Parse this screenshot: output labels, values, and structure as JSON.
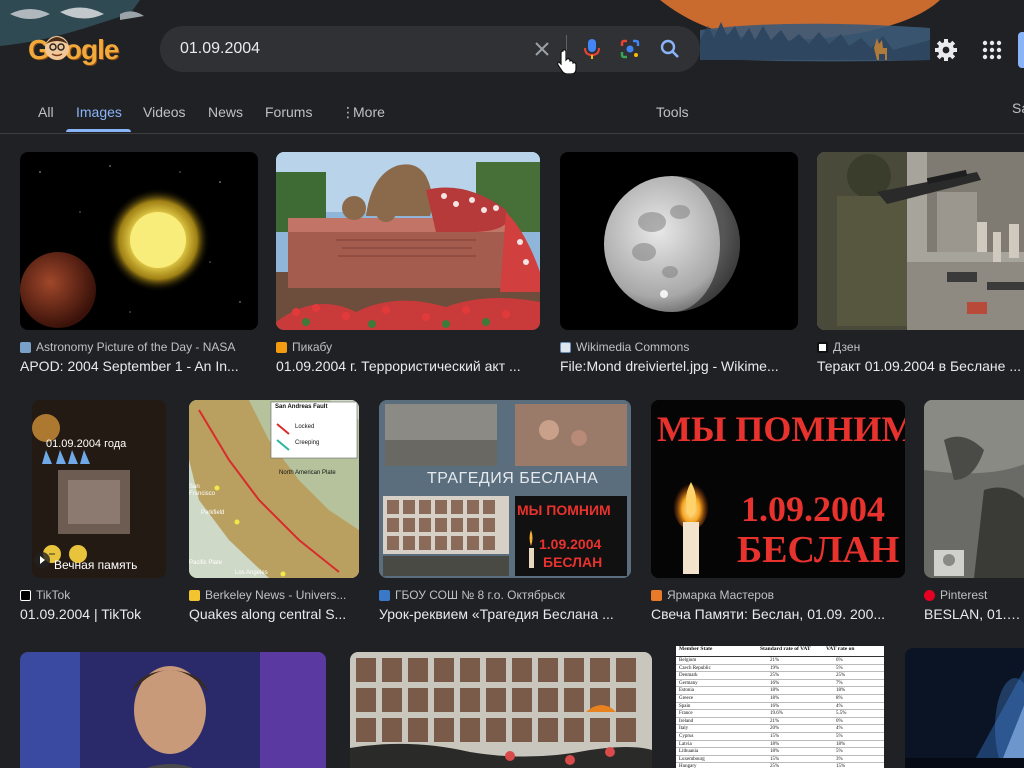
{
  "search": {
    "query": "01.09.2004"
  },
  "logo": {
    "text": "Google"
  },
  "tabs": {
    "all": "All",
    "images": "Images",
    "videos": "Videos",
    "news": "News",
    "forums": "Forums",
    "more": "More",
    "tools": "Tools",
    "safe_search_partial": "Sa"
  },
  "colors": {
    "accent": "#8ab4f8",
    "background": "#202124",
    "search_box": "#303134"
  },
  "results": [
    {
      "source": "Astronomy Picture of the Day - NASA",
      "title": "APOD: 2004 September 1 - An In..."
    },
    {
      "source": "Пикабу",
      "title": "01.09.2004 г. Террористический акт ..."
    },
    {
      "source": "Wikimedia Commons",
      "title": "File:Mond dreiviertel.jpg - Wikime..."
    },
    {
      "source": "Дзен",
      "title": "Теракт 01.09.2004 в Беслане ..."
    },
    {
      "source": "TikTok",
      "title": "01.09.2004 | TikTok",
      "overlay_text": "01.09.2004 года",
      "overlay_caption": "Вечная память"
    },
    {
      "source": "Berkeley News - Univers...",
      "title": "Quakes along central S...",
      "map": {
        "legend_title": "San Andreas Fault",
        "legend_locked": "Locked",
        "legend_creeping": "Creeping",
        "north_american_plate": "North American Plate",
        "pacific_plate": "Pacific Plate",
        "san_francisco": "San Francisco",
        "parkfield": "Parkfield",
        "los_angeles": "Los Angeles"
      }
    },
    {
      "source": "ГБОУ СОШ № 8 г.о. Октябрьск",
      "title": "Урок-реквием «Трагедия Беслана ...",
      "banner": "ТРАГЕДИЯ БЕСЛАНА",
      "small_line1": "МЫ ПОМНИМ",
      "small_line2": "1.09.2004",
      "small_line3": "БЕСЛАН"
    },
    {
      "source": "Ярмарка Мастеров",
      "title": "Свеча Памяти: Беслан, 01.09. 200...",
      "line1": "МЫ ПОМНИМ",
      "line2": "1.09.2004",
      "line3": "БЕСЛАН"
    },
    {
      "source": "Pinterest",
      "title": "BESLAN, 01.09..."
    },
    {
      "source": "",
      "title": ""
    },
    {
      "source": "",
      "title": ""
    },
    {
      "source": "",
      "title": ""
    },
    {
      "source": "",
      "title": ""
    }
  ],
  "vat_table": {
    "headers": [
      "Member State",
      "Standard rate of VAT",
      "VAT rate on"
    ],
    "rows": [
      [
        "Belgium",
        "21%",
        "6%"
      ],
      [
        "Czech Republic",
        "19%",
        "5%"
      ],
      [
        "Denmark",
        "25%",
        "25%"
      ],
      [
        "Germany",
        "16%",
        "7%"
      ],
      [
        "Estonia",
        "18%",
        "18%"
      ],
      [
        "Greece",
        "18%",
        "8%"
      ],
      [
        "Spain",
        "16%",
        "4%"
      ],
      [
        "France",
        "19.6%",
        "5.5%"
      ],
      [
        "Ireland",
        "21%",
        "0%"
      ],
      [
        "Italy",
        "20%",
        "4%"
      ],
      [
        "Cyprus",
        "15%",
        "5%"
      ],
      [
        "Latvia",
        "18%",
        "18%"
      ],
      [
        "Lithuania",
        "18%",
        "5%"
      ],
      [
        "Luxembourg",
        "15%",
        "3%"
      ],
      [
        "Hungary",
        "25%",
        "15%"
      ]
    ]
  }
}
